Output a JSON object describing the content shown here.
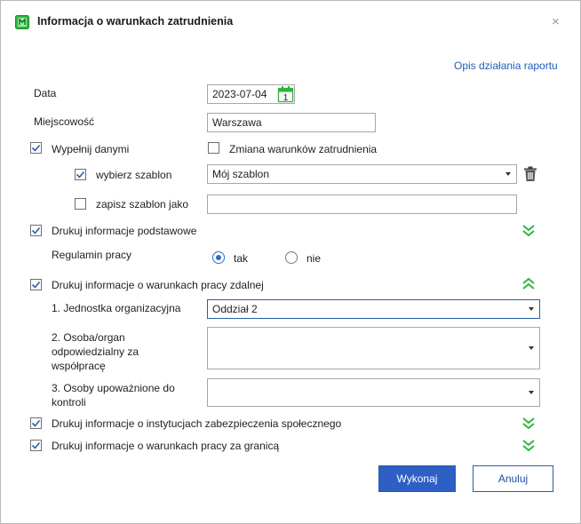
{
  "window": {
    "title": "Informacja o warunkach zatrudnienia",
    "close_label": "×"
  },
  "report_link": "Opis działania raportu",
  "fields": {
    "data_label": "Data",
    "data_value": "2023-07-04",
    "calendar_day": "1",
    "miejscowosc_label": "Miejscowość",
    "miejscowosc_value": "Warszawa"
  },
  "fill": {
    "wypelnij_label": "Wypełnij danymi",
    "wypelnij_checked": true,
    "zmiana_label": "Zmiana warunków zatrudnienia",
    "zmiana_checked": false,
    "wybierz_label": "wybierz szablon",
    "wybierz_checked": true,
    "szablon_value": "Mój szablon",
    "zapisz_label": "zapisz szablon jako",
    "zapisz_checked": false,
    "zapisz_value": ""
  },
  "basic": {
    "label": "Drukuj informacje podstawowe",
    "checked": true,
    "regulamin_label": "Regulamin pracy",
    "tak_label": "tak",
    "nie_label": "nie",
    "selected": "tak"
  },
  "remote": {
    "label": "Drukuj informacje o warunkach pracy zdalnej",
    "checked": true,
    "jednostka_label": "1. Jednostka organizacyjna",
    "jednostka_value": "Oddział 2",
    "osoba_label_1": "2. Osoba/organ",
    "osoba_label_2": "odpowiedzialny za",
    "osoba_label_3": "współpracę",
    "osoba_value": "",
    "upowaznione_label_1": "3. Osoby upoważnione do",
    "upowaznione_label_2": "kontroli",
    "upowaznione_value": ""
  },
  "social": {
    "label": "Drukuj informacje o instytucjach zabezpieczenia społecznego",
    "checked": true
  },
  "abroad": {
    "label": "Drukuj informacje o warunkach pracy za granicą",
    "checked": true
  },
  "buttons": {
    "execute": "Wykonaj",
    "cancel": "Anuluj"
  },
  "colors": {
    "accent": "#2d5fc4",
    "link": "#1f5fb8",
    "green": "#2fb53d"
  },
  "icons": {
    "app": "app-icon",
    "calendar": "calendar-icon",
    "trash": "trash-icon",
    "expand": "double-chevron-down-icon",
    "collapse": "double-chevron-up-icon"
  }
}
